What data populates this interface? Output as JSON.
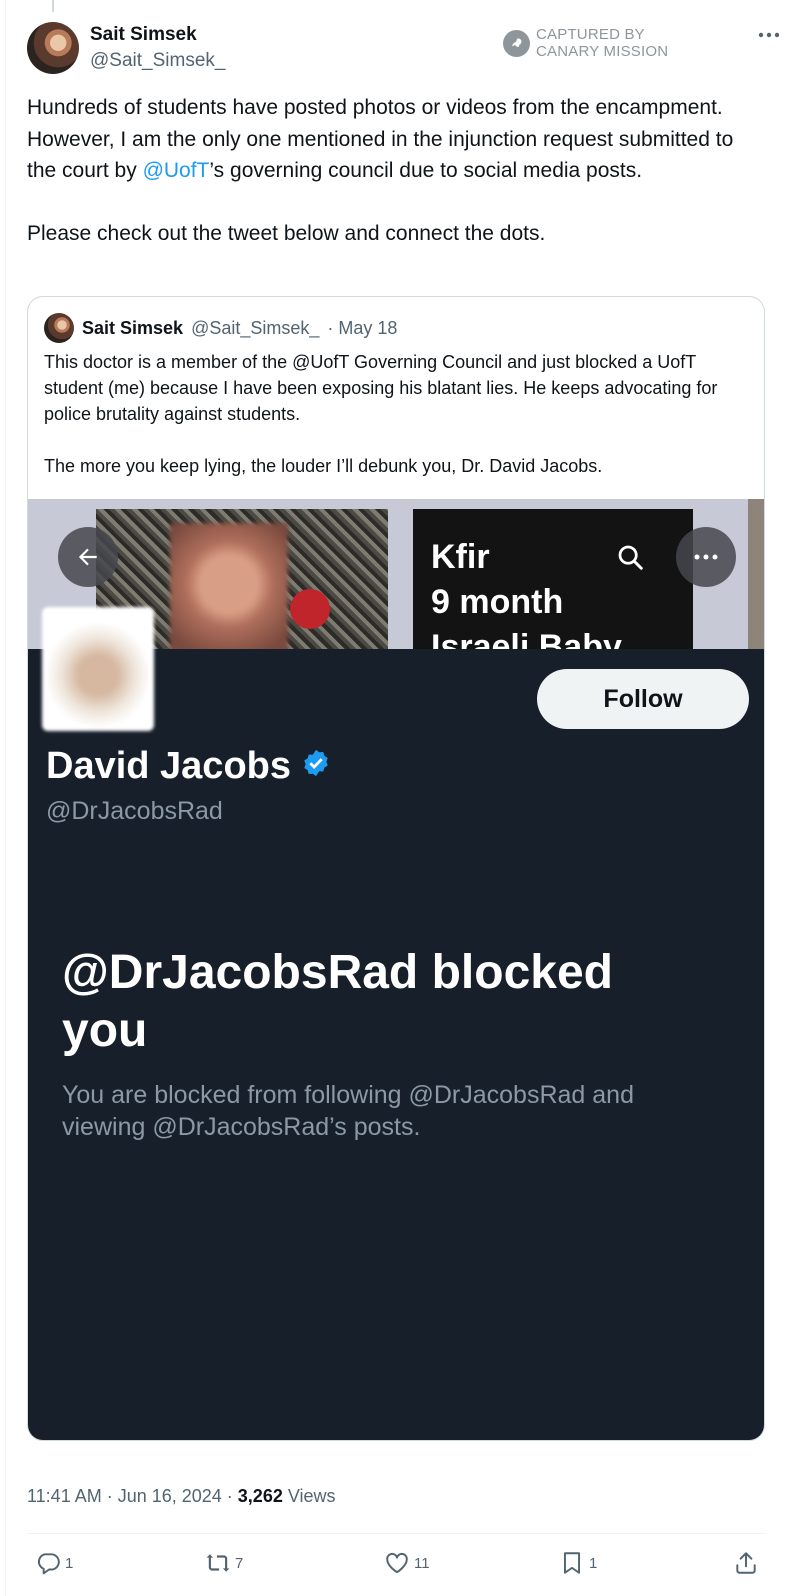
{
  "tweet": {
    "author_name": "Sait Simsek",
    "author_handle": "@Sait_Simsek_",
    "watermark": "CAPTURED BY CANARY MISSION",
    "text_1a": "Hundreds of students have posted photos or videos from the encampment. However, I am the only one mentioned in the injunction request submitted to the court by ",
    "text_1_mention": "@UofT",
    "text_1b": "’s governing council due to social media posts.",
    "text_2": "Please check out the tweet below and connect the dots.",
    "timestamp": "11:41 AM · Jun 16, 2024 · ",
    "views_count": "3,262",
    "views_label": " Views",
    "actions": {
      "replies": "1",
      "reposts": "7",
      "likes": "11",
      "bookmarks": "1"
    }
  },
  "quote": {
    "author_name": "Sait Simsek",
    "author_handle": "@Sait_Simsek_",
    "date": "· May 18",
    "text_1": "This doctor is a member of the @UofT Governing Council and just blocked a UofT student (me) because I have been exposing his blatant lies. He keeps advocating for police brutality against students.",
    "text_2": "The more you keep lying, the louder I’ll debunk you, Dr. David Jacobs."
  },
  "profile_screenshot": {
    "banner_text": [
      "Kfir",
      "9 month",
      "Israeli Baby"
    ],
    "name": "David Jacobs",
    "handle": "@DrJacobsRad",
    "follow_label": "Follow",
    "blocked_title": "@DrJacobsRad blocked you",
    "blocked_sub": "You are blocked from following @DrJacobsRad and viewing @DrJacobsRad’s posts."
  },
  "colors": {
    "accent": "#1d9bf0",
    "profile_bg": "#17202a",
    "muted": "#536471"
  },
  "icons": [
    "more-icon",
    "canary-logo-icon",
    "back-arrow-icon",
    "search-icon",
    "verified-badge-icon",
    "reply-icon",
    "repost-icon",
    "like-icon",
    "bookmark-icon",
    "share-icon"
  ]
}
